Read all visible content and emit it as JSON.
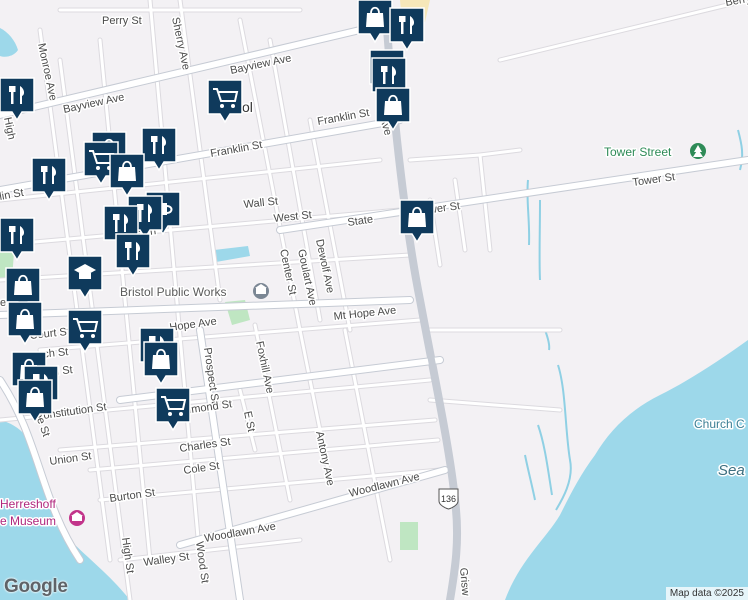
{
  "map": {
    "place_label": "Bristol",
    "streets": [
      {
        "id": "perry-st",
        "text": "Perry St"
      },
      {
        "id": "bayview-ave-ne",
        "text": "Bayview Ave"
      },
      {
        "id": "bayview-ave-w",
        "text": "Bayview Ave"
      },
      {
        "id": "sherry-ave",
        "text": "Sherry Ave"
      },
      {
        "id": "monroe-ave",
        "text": "Monroe Ave"
      },
      {
        "id": "high-st-n",
        "text": "High"
      },
      {
        "id": "franklin-st",
        "text": "Franklin St"
      },
      {
        "id": "franklin-st-e",
        "text": "Franklin St"
      },
      {
        "id": "franklin-st-w",
        "text": "lin St"
      },
      {
        "id": "wall-st",
        "text": "Wall St"
      },
      {
        "id": "west-st",
        "text": "West St"
      },
      {
        "id": "state-st",
        "text": "State"
      },
      {
        "id": "tower-st-w",
        "text": "Tower St"
      },
      {
        "id": "tower-st-e",
        "text": "Tower St"
      },
      {
        "id": "dewolf-ave",
        "text": "Dewolf Ave"
      },
      {
        "id": "goulart-ave",
        "text": "Goulart Ave"
      },
      {
        "id": "center-st",
        "text": "Center St"
      },
      {
        "id": "ws-ln",
        "text": "ws Ln"
      },
      {
        "id": "mt-hope-ave",
        "text": "Mt Hope Ave"
      },
      {
        "id": "hope-ave",
        "text": "Hope Ave"
      },
      {
        "id": "court-st",
        "text": "Court St"
      },
      {
        "id": "church-st",
        "text": "rch St"
      },
      {
        "id": "field-st",
        "text": "eld St"
      },
      {
        "id": "e-st",
        "text": "e St"
      },
      {
        "id": "prospect-st",
        "text": "Prospect St"
      },
      {
        "id": "foxhill-ave",
        "text": "Foxhill Ave"
      },
      {
        "id": "constitution-st",
        "text": "Constitution St"
      },
      {
        "id": "richmond-st",
        "text": "Richmond St"
      },
      {
        "id": "e-st-2",
        "text": "E St"
      },
      {
        "id": "charles-st",
        "text": "Charles St"
      },
      {
        "id": "union-st",
        "text": "Union St"
      },
      {
        "id": "cole-st",
        "text": "Cole St"
      },
      {
        "id": "antony-ave",
        "text": "Antony Ave"
      },
      {
        "id": "burton-st",
        "text": "Burton St"
      },
      {
        "id": "woodlawn-ave-e",
        "text": "Woodlawn Ave"
      },
      {
        "id": "woodlawn-ave-w",
        "text": "Woodlawn Ave"
      },
      {
        "id": "hope-st-s",
        "text": "Hope St"
      },
      {
        "id": "high-st-s",
        "text": "High St"
      },
      {
        "id": "walley-st",
        "text": "Walley St"
      },
      {
        "id": "wood-st",
        "text": "Wood St"
      },
      {
        "id": "griswold",
        "text": "Grisw"
      },
      {
        "id": "berry",
        "text": "Berry"
      }
    ],
    "pois": [
      {
        "id": "tower-street-park",
        "text": "Tower Street"
      },
      {
        "id": "bristol-public-works",
        "text": "Bristol Public Works"
      },
      {
        "id": "herreshoff-1",
        "text": "Herreshoff"
      },
      {
        "id": "herreshoff-2",
        "text": "e Museum"
      }
    ],
    "water_labels": [
      {
        "id": "church-cove",
        "text": "Church C"
      },
      {
        "id": "sea",
        "text": "Sea"
      }
    ],
    "route_shield": "136"
  },
  "attribution": "Map data ©2025",
  "logo": "Google",
  "colors": {
    "land": "#f3f1f4",
    "water": "#9dd8ea",
    "park": "#bfe6c2",
    "marker": "#0f3a5c",
    "main_road": "#c6cbd4"
  }
}
